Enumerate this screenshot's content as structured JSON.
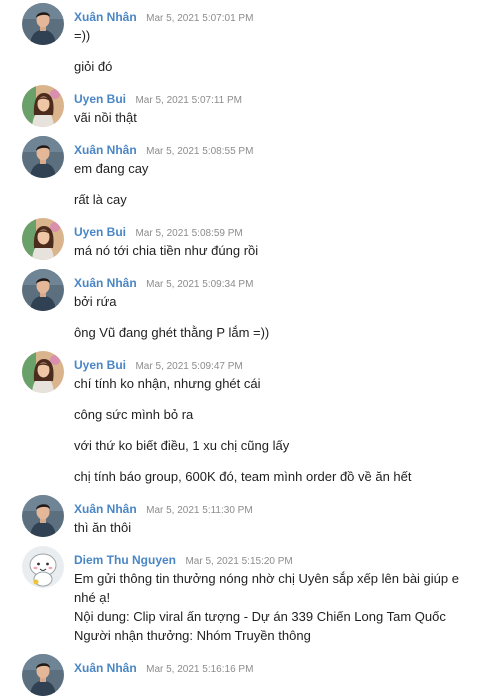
{
  "colors": {
    "name_xuan": "#4a86c5",
    "name_uyen": "#4a86c5",
    "name_diem": "#4a86c5",
    "timestamp": "#8c8c8c",
    "text": "#1f1f1f"
  },
  "messages": [
    {
      "sender": "Xuân Nhân",
      "time": "Mar 5, 2021 5:07:01 PM",
      "avatar": "avatar-xuan-nhan",
      "lines": [
        "=))",
        "giỏi đó"
      ]
    },
    {
      "sender": "Uyen Bui",
      "time": "Mar 5, 2021 5:07:11 PM",
      "avatar": "avatar-uyen-bui",
      "lines": [
        "vãi nồi thật"
      ]
    },
    {
      "sender": "Xuân Nhân",
      "time": "Mar 5, 2021 5:08:55 PM",
      "avatar": "avatar-xuan-nhan",
      "lines": [
        "em đang cay",
        "rất là cay"
      ]
    },
    {
      "sender": "Uyen Bui",
      "time": "Mar 5, 2021 5:08:59 PM",
      "avatar": "avatar-uyen-bui",
      "lines": [
        "má nó tới chia tiền như đúng rồi"
      ]
    },
    {
      "sender": "Xuân Nhân",
      "time": "Mar 5, 2021 5:09:34 PM",
      "avatar": "avatar-xuan-nhan",
      "lines": [
        "bởi rứa",
        "ông Vũ đang ghét thằng P lắm =))"
      ]
    },
    {
      "sender": "Uyen Bui",
      "time": "Mar 5, 2021 5:09:47 PM",
      "avatar": "avatar-uyen-bui",
      "lines": [
        "chí tính ko nhận, nhưng ghét cái",
        "công sức mình bỏ ra",
        "với thứ ko biết điều, 1 xu chị cũng lấy",
        "chị tính báo group, 600K đó, team mình order đồ về ăn hết"
      ]
    },
    {
      "sender": "Xuân Nhân",
      "time": "Mar 5, 2021 5:11:30 PM",
      "avatar": "avatar-xuan-nhan",
      "lines": [
        "thì ăn thôi"
      ]
    },
    {
      "sender": "Diem Thu Nguyen",
      "time": "Mar 5, 2021 5:15:20 PM",
      "avatar": "avatar-diem-thu-nguyen",
      "lines": [
        "Em gửi thông tin thưởng nóng nhờ chị Uyên sắp xếp lên bài giúp e nhé ạ!",
        "Nội dung: Clip viral ấn tượng - Dự án 339 Chiến Long Tam Quốc",
        "Người nhận thưởng: Nhóm Truyền thông"
      ]
    },
    {
      "sender": "Xuân Nhân",
      "time": "Mar 5, 2021 5:16:16 PM",
      "avatar": "avatar-xuan-nhan",
      "lines": []
    }
  ]
}
